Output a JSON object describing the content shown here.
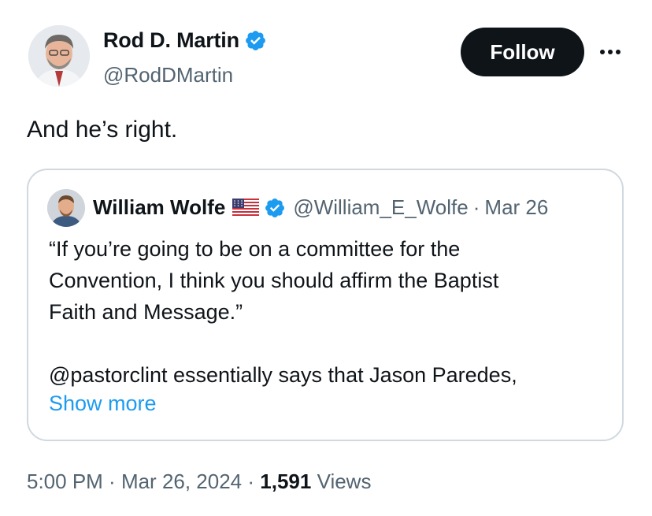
{
  "author": {
    "name": "Rod D. Martin",
    "handle": "@RodDMartin",
    "verified": true
  },
  "follow_button": {
    "label": "Follow"
  },
  "more_icon": "more-horizontal-icon",
  "tweet": {
    "text": "And he’s right."
  },
  "quoted_tweet": {
    "author_name": "William Wolfe",
    "flag": "us-flag-icon",
    "verified": true,
    "handle": "@William_E_Wolfe",
    "separator": "·",
    "date": "Mar 26",
    "quote_lines": [
      "“If you’re going to be on a committee for the",
      "Convention, I think you should affirm the Baptist",
      "Faith and Message.”"
    ],
    "mention_line": "@pastorclint essentially says that Jason Paredes,",
    "show_more": "Show more"
  },
  "meta": {
    "time": "5:00 PM",
    "sep1": " · ",
    "date": "Mar 26, 2024",
    "sep2": " · ",
    "views_count": "1,591",
    "views_label": " Views"
  },
  "colors": {
    "text": "#0f1419",
    "secondary": "#536471",
    "link": "#1d9bf0",
    "verified": "#1d9bf0",
    "border": "#cfd9de"
  }
}
